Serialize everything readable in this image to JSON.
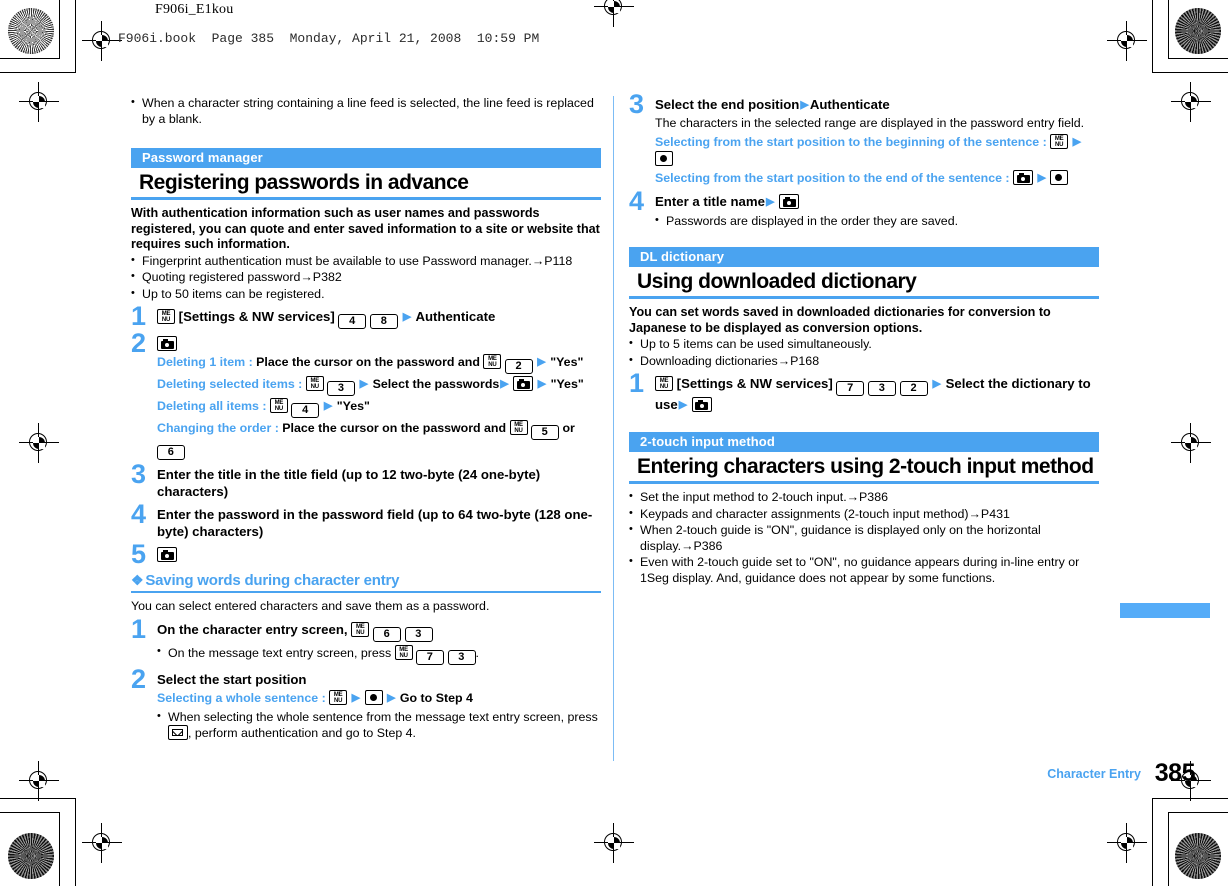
{
  "running_head": {
    "book_title": "F906i_E1kou",
    "file_line": "F906i.book  Page 385  Monday, April 21, 2008  10:59 PM"
  },
  "colors": {
    "accent": "#4aa3f0",
    "tab": "#55acf8",
    "rule": "#7cbcf5",
    "text": "#000000"
  },
  "footer": {
    "chapter": "Character Entry",
    "page_number": "385"
  },
  "left_column": {
    "intro_bullets": [
      "When a character string containing a line feed is selected, the line feed is replaced by a blank."
    ],
    "section": {
      "tag": "Password manager",
      "title": "Registering passwords in advance",
      "lead": "With authentication information such as user names and passwords registered, you can quote and enter saved information to a site or website that requires such information.",
      "bullets": [
        "Fingerprint authentication must be available to use Password manager.→P118",
        "Quoting registered password→P382",
        "Up to 50 items can be registered."
      ],
      "steps": [
        {
          "num": "1",
          "text_before": "",
          "text_after": "[Settings & NW services]",
          "tail": "Authenticate",
          "keys": [
            "menu-key-icon",
            "key-4-icon",
            "key-8-icon"
          ]
        },
        {
          "num": "2",
          "keys": [
            "camera-key-icon"
          ],
          "captions": [
            {
              "label": "Deleting 1 item :",
              "body": "Place the cursor on the password and",
              "keys": [
                "menu-key-icon",
                "key-2-icon"
              ],
              "tail": "\"Yes\""
            },
            {
              "label": "Deleting selected items :",
              "body": "",
              "keys": [
                "menu-key-icon",
                "key-3-icon"
              ],
              "mid": "Select the passwords",
              "keys2": [
                "camera-key-icon"
              ],
              "tail": "\"Yes\""
            },
            {
              "label": "Deleting all items :",
              "body": "",
              "keys": [
                "menu-key-icon",
                "key-4-icon"
              ],
              "tail": "\"Yes\""
            },
            {
              "label": "Changing the order :",
              "body": "Place the cursor on the password and",
              "keys": [
                "menu-key-icon",
                "key-5-icon"
              ],
              "mid": "or",
              "keys2": [
                "key-6-icon"
              ],
              "tail": ""
            }
          ]
        },
        {
          "num": "3",
          "body": "Enter the title in the title field (up to 12 two-byte (24 one-byte) characters)"
        },
        {
          "num": "4",
          "body": "Enter the password in the password field (up to 64 two-byte (128 one-byte) characters)"
        },
        {
          "num": "5",
          "keys": [
            "camera-key-icon"
          ]
        }
      ]
    },
    "subsection": {
      "title": "Saving words during character entry",
      "intro": "You can select entered characters and save them as a password.",
      "steps": [
        {
          "num": "1",
          "body": "On the character entry screen,",
          "keys": [
            "menu-key-icon",
            "key-6-icon",
            "key-3-icon"
          ],
          "bullet_before": "On the message text entry screen, press",
          "bullet_keys": [
            "menu-key-icon",
            "key-7-icon",
            "key-3-icon"
          ],
          "bullet_after": "."
        },
        {
          "num": "2",
          "body": "Select the start position",
          "caption_label": "Selecting a whole sentence :",
          "caption_keys": [
            "menu-key-icon",
            "center-select-key-icon"
          ],
          "caption_tail": "Go to Step 4",
          "bullet_before": "When selecting the whole sentence from the message text entry screen, press",
          "bullet_keys": [
            "mail-key-icon"
          ],
          "bullet_after": ", perform authentication and go to Step 4."
        }
      ]
    }
  },
  "right_column": {
    "steps_continued": [
      {
        "num": "3",
        "body": "Select the end position",
        "tail": "Authenticate",
        "note": "The characters in the selected range are displayed in the password entry field.",
        "captions": [
          {
            "label": "Selecting from the start position to the beginning of the sentence :",
            "keys": [
              "menu-key-icon",
              "center-select-key-icon"
            ]
          },
          {
            "label": "Selecting from the start position to the end of the sentence :",
            "keys": [
              "camera-key-icon",
              "center-select-key-icon"
            ]
          }
        ]
      },
      {
        "num": "4",
        "body": "Enter a title name",
        "keys": [
          "camera-key-icon"
        ],
        "bullets": [
          "Passwords are displayed in the order they are saved."
        ]
      }
    ],
    "dl_dictionary": {
      "tag": "DL dictionary",
      "title": "Using downloaded dictionary",
      "lead": "You can set words saved in downloaded dictionaries for conversion to Japanese to be displayed as conversion options.",
      "bullets": [
        "Up to 5 items can be used simultaneously.",
        "Downloading dictionaries→P168"
      ],
      "step": {
        "num": "1",
        "label": "[Settings & NW services]",
        "keys": [
          "menu-key-icon",
          "key-7-icon",
          "key-3-icon",
          "key-2-icon"
        ],
        "tail": "Select the dictionary to use",
        "end_keys": [
          "camera-key-icon"
        ]
      }
    },
    "two_touch": {
      "tag": "2-touch input method",
      "title": "Entering characters using 2-touch input method",
      "bullets": [
        "Set the input method to 2-touch input.→P386",
        "Keypads and character assignments (2-touch input method)→P431",
        "When 2-touch guide is \"ON\", guidance is displayed only on the horizontal display.→P386",
        "Even with 2-touch guide set to \"ON\", no guidance appears during in-line entry or 1Seg display. And, guidance does not appear by some functions."
      ]
    }
  }
}
